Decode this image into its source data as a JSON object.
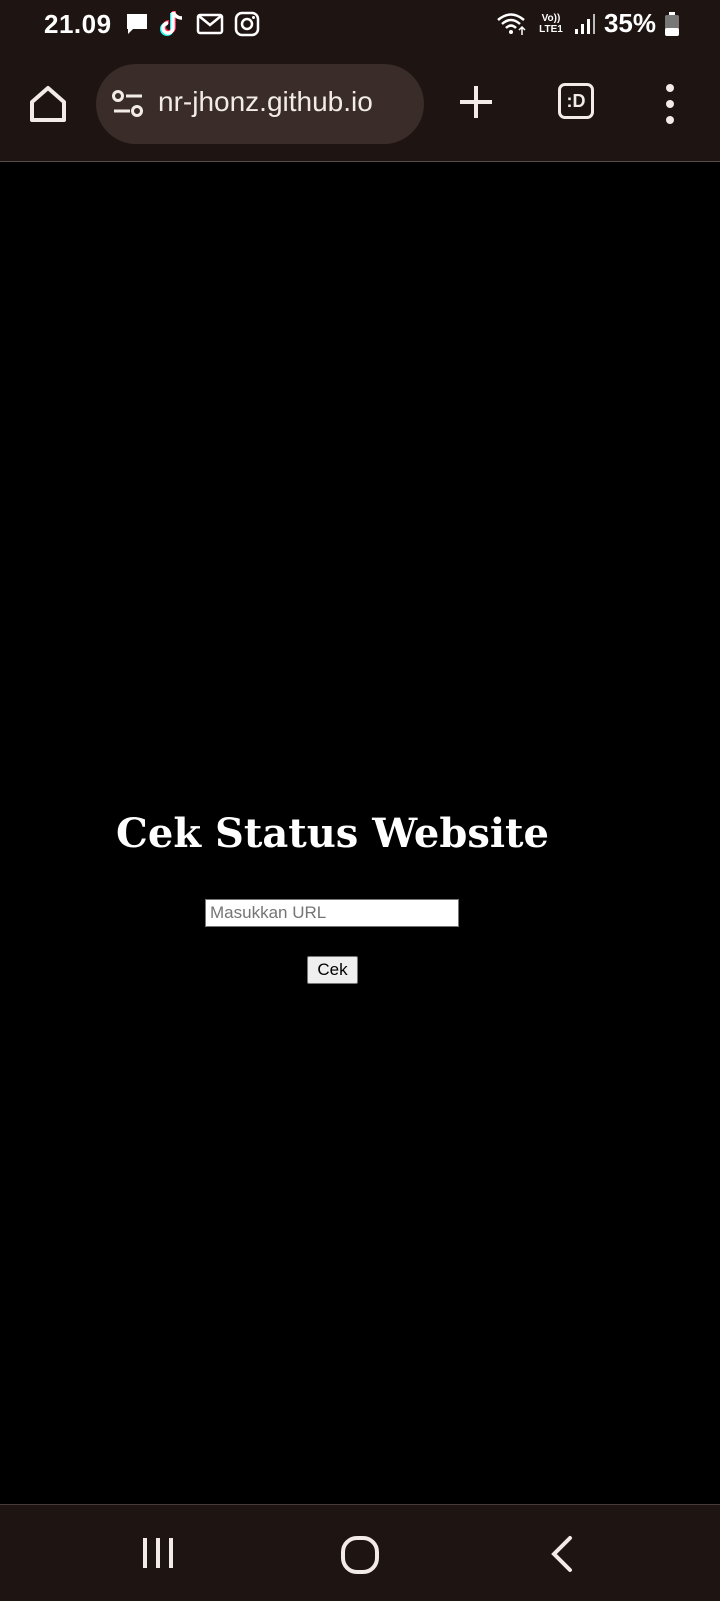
{
  "status_bar": {
    "time": "21.09",
    "notification_icons": [
      "chat-icon",
      "tiktok-icon",
      "gmail-icon",
      "instagram-icon"
    ],
    "network_label": "Vo)) LTE1",
    "battery_percent": "35%"
  },
  "browser": {
    "url": "nr-jhonz.github.io",
    "tabs_label": ":D"
  },
  "page": {
    "heading": "Cek Status Website",
    "url_input": {
      "placeholder": "Masukkan URL",
      "value": ""
    },
    "check_button_label": "Cek"
  },
  "colors": {
    "system_bar": "#1e1412",
    "url_box": "#3a2c28",
    "page_background": "#000000",
    "heading_text": "#ffffff"
  }
}
